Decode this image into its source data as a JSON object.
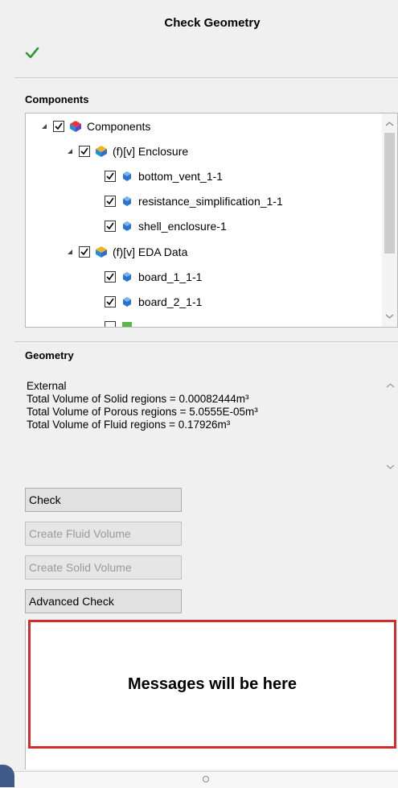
{
  "panel": {
    "title": "Check Geometry",
    "status_icon": "green-checkmark-icon",
    "accent_colors": {
      "ok": "#2e9b2e",
      "message_border": "#d12b2b"
    }
  },
  "components": {
    "label": "Components",
    "tree": [
      {
        "label": "Components",
        "checked": true,
        "expanded": true,
        "icon": "assembly-icon"
      },
      {
        "label": "(f)[v] Enclosure",
        "checked": true,
        "expanded": true,
        "icon": "subassembly-icon"
      },
      {
        "label": "bottom_vent_1-1",
        "checked": true,
        "icon": "part-icon"
      },
      {
        "label": "resistance_simplification_1-1",
        "checked": true,
        "icon": "part-icon"
      },
      {
        "label": "shell_enclosure-1",
        "checked": true,
        "icon": "part-icon"
      },
      {
        "label": "(f)[v] EDA Data",
        "checked": true,
        "expanded": true,
        "icon": "subassembly-icon"
      },
      {
        "label": "board_1_1-1",
        "checked": true,
        "icon": "part-icon"
      },
      {
        "label": "board_2_1-1",
        "checked": true,
        "icon": "part-icon"
      }
    ]
  },
  "geometry": {
    "label": "Geometry",
    "lines": [
      "External",
      "Total Volume of Solid regions = 0.00082444m³",
      "Total Volume of Porous regions = 5.0555E-05m³",
      "Total Volume of Fluid regions = 0.17926m³"
    ]
  },
  "buttons": {
    "check": "Check",
    "create_fluid": "Create Fluid Volume",
    "create_solid": "Create Solid Volume",
    "advanced": "Advanced Check"
  },
  "messages": {
    "placeholder": "Messages will be here"
  }
}
